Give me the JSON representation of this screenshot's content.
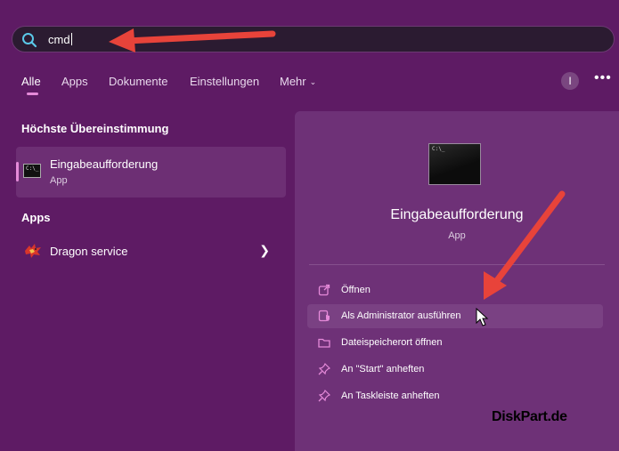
{
  "search": {
    "query": "cmd"
  },
  "tabs": [
    {
      "label": "Alle"
    },
    {
      "label": "Apps"
    },
    {
      "label": "Dokumente"
    },
    {
      "label": "Einstellungen"
    },
    {
      "label": "Mehr"
    }
  ],
  "header_actions": {
    "info_badge": "I",
    "more": "•••"
  },
  "best_match": {
    "heading": "Höchste Übereinstimmung",
    "title": "Eingabeaufforderung",
    "subtitle": "App",
    "icon": "cmd-icon"
  },
  "apps": {
    "heading": "Apps",
    "items": [
      {
        "label": "Dragon service",
        "icon": "dragon-icon"
      }
    ]
  },
  "preview": {
    "title": "Eingabeaufforderung",
    "subtitle": "App",
    "actions": [
      {
        "label": "Öffnen",
        "icon": "open-external-icon"
      },
      {
        "label": "Als Administrator ausführen",
        "icon": "admin-shield-icon"
      },
      {
        "label": "Dateispeicherort öffnen",
        "icon": "folder-icon"
      },
      {
        "label": "An \"Start\" anheften",
        "icon": "pin-icon"
      },
      {
        "label": "An Taskleiste anheften",
        "icon": "pin-icon"
      }
    ]
  },
  "watermark": "DiskPart.de",
  "colors": {
    "background": "#5e1b64",
    "panel": "#6e3177",
    "accent": "#e58ad9",
    "arrow": "#e8433a"
  }
}
